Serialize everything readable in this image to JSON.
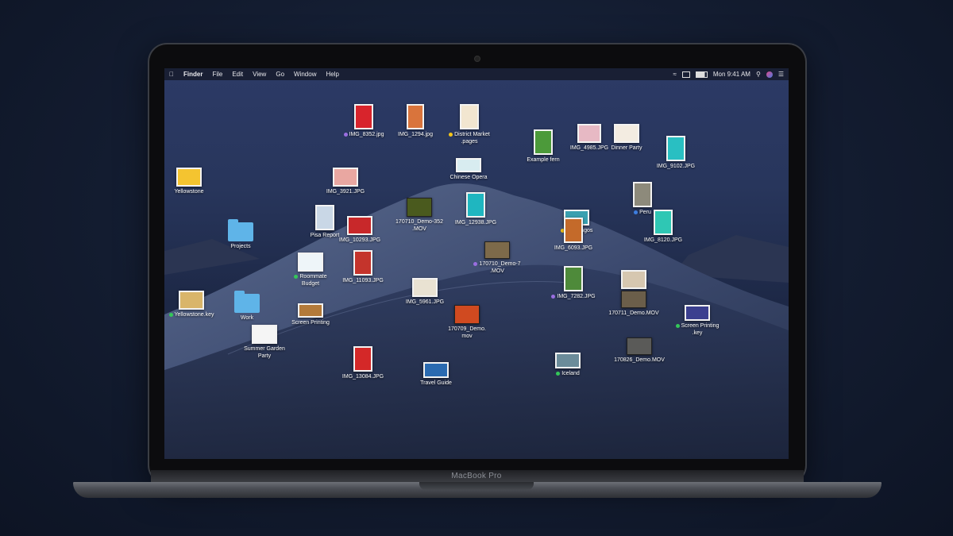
{
  "menubar": {
    "apple_icon": "apple-icon",
    "app_name": "Finder",
    "menus": [
      "File",
      "Edit",
      "View",
      "Go",
      "Window",
      "Help"
    ],
    "clock": "Mon 9:41 AM",
    "status_icons": [
      "wifi-icon",
      "airplay-icon",
      "battery-icon",
      "spotlight-icon",
      "siri-icon",
      "notification-center-icon"
    ]
  },
  "desktop_items": [
    {
      "label": "IMG_8352.jpg",
      "tag": "#9a6ee0",
      "kind": "photo",
      "color": "#d8242c"
    },
    {
      "label": "IMG_1294.jpg",
      "tag": null,
      "kind": "photo",
      "color": "#d9743c"
    },
    {
      "label": "District Market\n.pages",
      "tag": "#f5c518",
      "kind": "doc",
      "color": "#f2e6d0"
    },
    {
      "label": "Example fern",
      "tag": null,
      "kind": "photo",
      "color": "#4c9a3a"
    },
    {
      "label": "IMG_4985.JPG",
      "tag": null,
      "kind": "photo",
      "color": "#e7b9c4"
    },
    {
      "label": "Dinner Party",
      "tag": null,
      "kind": "doc",
      "color": "#f3ece1"
    },
    {
      "label": "IMG_9102.JPG",
      "tag": null,
      "kind": "photo",
      "color": "#29bfc2"
    },
    {
      "label": "Yellowstone",
      "tag": null,
      "kind": "doc",
      "color": "#f4c430"
    },
    {
      "label": "IMG_3921.JPG",
      "tag": null,
      "kind": "photo",
      "color": "#e9a7a1"
    },
    {
      "label": "Chinese Opera",
      "tag": null,
      "kind": "photo",
      "color": "#d8ecf0"
    },
    {
      "label": "Peru",
      "tag": "#3d7ee0",
      "kind": "photo",
      "color": "#8d8a7b"
    },
    {
      "label": "170710_Demo-352\n.MOV",
      "tag": null,
      "kind": "movie",
      "color": "#4a5a1e"
    },
    {
      "label": "IMG_12938.JPG",
      "tag": null,
      "kind": "photo",
      "color": "#1fb6c0"
    },
    {
      "label": "Galapagos",
      "tag": "#f5c518",
      "kind": "photo",
      "color": "#3aa0b0"
    },
    {
      "label": "IMG_8120.JPG",
      "tag": null,
      "kind": "photo",
      "color": "#2fc7b4"
    },
    {
      "label": "Projects",
      "tag": null,
      "kind": "folder",
      "color": "#5fb4e8"
    },
    {
      "label": "Pisa Report",
      "tag": null,
      "kind": "photo",
      "color": "#c9d7e6"
    },
    {
      "label": "IMG_10293.JPG",
      "tag": null,
      "kind": "photo",
      "color": "#c8282a"
    },
    {
      "label": "IMG_6093.JPG",
      "tag": null,
      "kind": "photo",
      "color": "#c46a2a"
    },
    {
      "label": "170710_Demo-7\n.MOV",
      "tag": "#9a6ee0",
      "kind": "movie",
      "color": "#7d6a4a"
    },
    {
      "label": "Roommate\nBudget",
      "tag": "#34c759",
      "kind": "doc",
      "color": "#eef5f9"
    },
    {
      "label": "IMG_11093.JPG",
      "tag": null,
      "kind": "photo",
      "color": "#c4342c"
    },
    {
      "label": "IMG_7282.JPG",
      "tag": "#9a6ee0",
      "kind": "photo",
      "color": "#4e8a3a"
    },
    {
      "label": "Histo\nSkateb...",
      "tag": null,
      "kind": "doc",
      "color": "#d6c7b0"
    },
    {
      "label": "170711_Demo.MOV",
      "tag": null,
      "kind": "movie",
      "color": "#6b5e4a"
    },
    {
      "label": "Yellowstone.key",
      "tag": "#34c759",
      "kind": "doc",
      "color": "#d9b56a"
    },
    {
      "label": "Work",
      "tag": null,
      "kind": "folder",
      "color": "#5fb4e8"
    },
    {
      "label": "IMG_5961.JPG",
      "tag": null,
      "kind": "photo",
      "color": "#e9e2d2"
    },
    {
      "label": "Screen Printing",
      "tag": null,
      "kind": "doc",
      "color": "#b37a3a"
    },
    {
      "label": "170709_Demo.\nmov",
      "tag": null,
      "kind": "movie",
      "color": "#d04a20"
    },
    {
      "label": "Screen Printing\n.key",
      "tag": "#34c759",
      "kind": "doc",
      "color": "#3b3f8f"
    },
    {
      "label": "Summer Garden\nParty",
      "tag": null,
      "kind": "doc",
      "color": "#f5f5f5"
    },
    {
      "label": "170826_Demo.MOV",
      "tag": null,
      "kind": "movie",
      "color": "#5a5a58"
    },
    {
      "label": "Iceland",
      "tag": "#34c759",
      "kind": "photo",
      "color": "#6b8c9a"
    },
    {
      "label": "IMG_13084.JPG",
      "tag": null,
      "kind": "photo",
      "color": "#d42828"
    },
    {
      "label": "Travel Guide",
      "tag": null,
      "kind": "photo",
      "color": "#2a6ab0"
    }
  ],
  "dock": {
    "apps": [
      {
        "name": "finder-icon",
        "color": "#3a8ee6",
        "glyph": "☺"
      },
      {
        "name": "siri-icon",
        "color": "#6a3ad0",
        "glyph": "◉"
      },
      {
        "name": "launchpad-icon",
        "color": "#8a8f99",
        "glyph": "🚀"
      },
      {
        "name": "safari-icon",
        "color": "#2a8ae6",
        "glyph": "⊘"
      },
      {
        "name": "mail-icon",
        "color": "#6aa6e6",
        "glyph": "✉"
      },
      {
        "name": "contacts-icon",
        "color": "#b08a5a",
        "glyph": "▤"
      },
      {
        "name": "calendar-icon",
        "color": "#f6f6f6",
        "glyph": "4"
      },
      {
        "name": "notes-icon",
        "color": "#f5e07a",
        "glyph": "≡"
      },
      {
        "name": "reminders-icon",
        "color": "#f6f6f6",
        "glyph": "☷"
      },
      {
        "name": "maps-icon",
        "color": "#5ab85a",
        "glyph": "➤"
      },
      {
        "name": "photos-icon",
        "color": "#f0f0f0",
        "glyph": "✿"
      },
      {
        "name": "messages-icon",
        "color": "#2ab0f0",
        "glyph": "…"
      },
      {
        "name": "facetime-icon",
        "color": "#34c759",
        "glyph": "▶"
      },
      {
        "name": "pages-icon",
        "color": "#f39a2a",
        "glyph": "✎"
      },
      {
        "name": "numbers-icon",
        "color": "#f6f6f6",
        "glyph": "▮"
      },
      {
        "name": "keynote-icon",
        "color": "#2a7ae6",
        "glyph": "⊥"
      },
      {
        "name": "itunes-icon",
        "color": "#f04a8a",
        "glyph": "♫"
      },
      {
        "name": "app-store-icon",
        "color": "#2a8ae6",
        "glyph": "A"
      },
      {
        "name": "system-preferences-icon",
        "color": "#8a8f99",
        "glyph": "⚙"
      }
    ],
    "right": [
      {
        "name": "downloads-folder-icon",
        "color": "#5fb4e8",
        "glyph": "⌂"
      },
      {
        "name": "trash-icon",
        "color": "#5b5f66",
        "glyph": "🗑"
      }
    ]
  },
  "hardware": {
    "brand": "MacBook Pro"
  }
}
